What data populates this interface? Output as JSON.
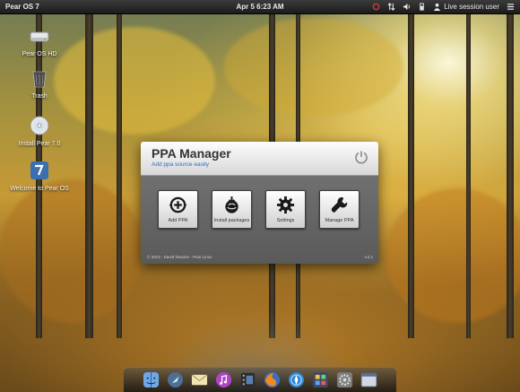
{
  "top_panel": {
    "os_menu": "Pear OS 7",
    "clock": "Apr 5  6:23 AM",
    "user": "Live session user",
    "tray_icons": [
      "power-status-icon",
      "network-icon",
      "volume-icon",
      "battery-icon",
      "user-icon",
      "menu-icon"
    ]
  },
  "desktop_icons": [
    {
      "name": "drive-icon",
      "label": "Pear OS HD"
    },
    {
      "name": "trash-icon",
      "label": "Trash"
    },
    {
      "name": "cd-icon",
      "label": "Install Pear 7.0"
    },
    {
      "name": "welcome-icon",
      "label": "Welcome to Pear OS"
    }
  ],
  "ppa_window": {
    "title": "PPA Manager",
    "subtitle": "Add ppa source easily",
    "buttons": [
      {
        "icon": "add-icon",
        "label": "Add PPA"
      },
      {
        "icon": "install-icon",
        "label": "Install packages"
      },
      {
        "icon": "gear-icon",
        "label": "Settings"
      },
      {
        "icon": "wrench-icon",
        "label": "Manage PPA"
      }
    ],
    "footer_left": "© 2013 - David Tavares - Pear Linux",
    "footer_right": "v.2.1"
  },
  "dock_items": [
    "finder-icon",
    "launchpad-icon",
    "mail-icon",
    "music-icon",
    "film-icon",
    "firefox-icon",
    "web-browser-icon",
    "app-center-icon",
    "settings-icon",
    "window-icon"
  ],
  "colors": {
    "subtitle_blue": "#2b6fc0",
    "panel_dark": "#1c1c1c",
    "window_body": "#606060"
  }
}
